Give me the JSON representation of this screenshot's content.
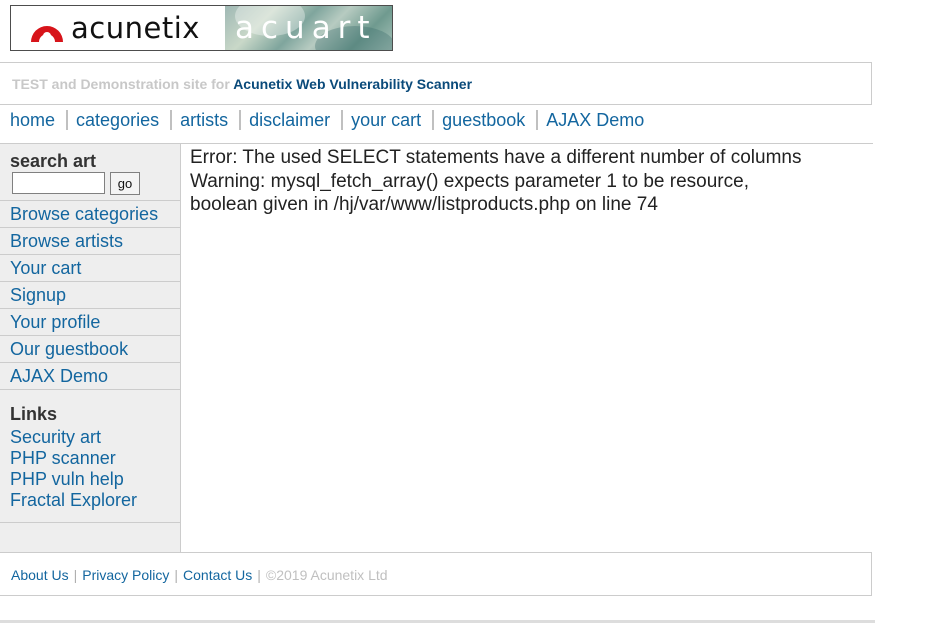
{
  "logo": {
    "left_text": "acunetix",
    "right_text": "acuart",
    "colors": {
      "swirl": "#d7141a"
    }
  },
  "tagline": {
    "prefix": "TEST and Demonstration site for",
    "product": "Acunetix Web Vulnerability Scanner"
  },
  "nav": {
    "items": [
      "home",
      "categories",
      "artists",
      "disclaimer",
      "your cart",
      "guestbook",
      "AJAX Demo"
    ]
  },
  "sidebar": {
    "search_title": "search art",
    "search_value": "",
    "go_label": "go",
    "menu": [
      "Browse categories",
      "Browse artists",
      "Your cart",
      "Signup",
      "Your profile",
      "Our guestbook",
      "AJAX Demo"
    ],
    "links_title": "Links",
    "links": [
      "Security art",
      "PHP scanner",
      "PHP vuln help",
      "Fractal Explorer"
    ]
  },
  "content": {
    "error_line": "Error: The used SELECT statements have a different number of columns",
    "warning_line1": "Warning: mysql_fetch_array() expects parameter 1 to be resource,",
    "warning_line2": "boolean given in /hj/var/www/listproducts.php on line 74"
  },
  "footer": {
    "links": [
      "About Us",
      "Privacy Policy",
      "Contact Us"
    ],
    "copyright": "©2019 Acunetix Ltd"
  },
  "colors": {
    "link": "#13669f",
    "sidebar_bg": "#eeeeee",
    "rule": "#cccccc"
  }
}
